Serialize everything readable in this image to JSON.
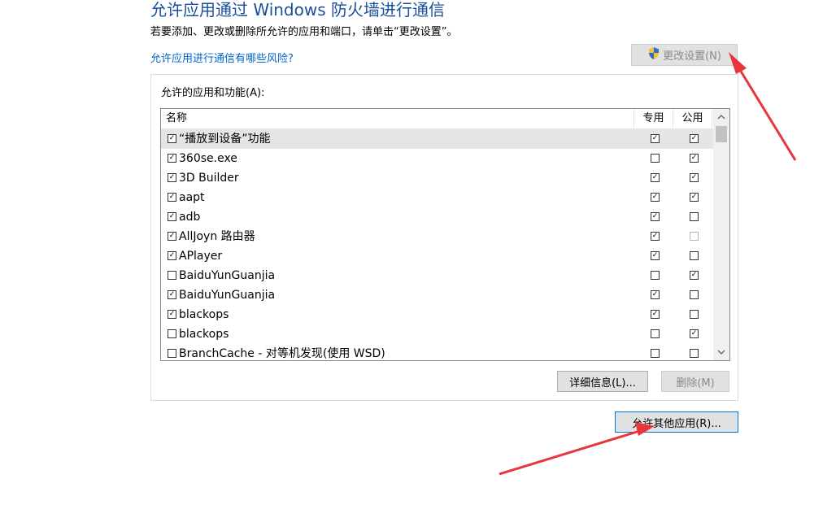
{
  "header": {
    "title": "允许应用通过 Windows 防火墙进行通信",
    "description": "若要添加、更改或删除所允许的应用和端口，请单击“更改设置”。",
    "risk_link": "允许应用进行通信有哪些风险?",
    "change_settings_label": "更改设置(N)"
  },
  "group": {
    "label": "允许的应用和功能(A):"
  },
  "table": {
    "columns": {
      "name": "名称",
      "private": "专用",
      "public": "公用"
    },
    "rows": [
      {
        "name": "“播放到设备”功能",
        "enabled": true,
        "private": true,
        "public": true
      },
      {
        "name": "360se.exe",
        "enabled": true,
        "private": false,
        "public": true
      },
      {
        "name": "3D Builder",
        "enabled": true,
        "private": true,
        "public": true
      },
      {
        "name": "aapt",
        "enabled": true,
        "private": true,
        "public": true
      },
      {
        "name": "adb",
        "enabled": true,
        "private": true,
        "public": false
      },
      {
        "name": "AllJoyn 路由器",
        "enabled": true,
        "private": true,
        "public": false
      },
      {
        "name": "APlayer",
        "enabled": true,
        "private": true,
        "public": false
      },
      {
        "name": "BaiduYunGuanjia",
        "enabled": false,
        "private": false,
        "public": true
      },
      {
        "name": "BaiduYunGuanjia",
        "enabled": true,
        "private": true,
        "public": false
      },
      {
        "name": "blackops",
        "enabled": true,
        "private": true,
        "public": false
      },
      {
        "name": "blackops",
        "enabled": false,
        "private": false,
        "public": true
      },
      {
        "name": "BranchCache - 对等机发现(使用 WSD)",
        "enabled": false,
        "private": false,
        "public": false
      }
    ]
  },
  "buttons": {
    "details": "详细信息(L)...",
    "delete": "删除(M)",
    "allow_other": "允许其他应用(R)..."
  },
  "colors": {
    "title": "#1a4f9c",
    "link": "#0066cc",
    "annotation_arrow": "#e8343a",
    "focus_border": "#0078d7"
  },
  "icons": {
    "shield": "uac-shield-icon",
    "scroll_up": "chevron-up-icon",
    "scroll_down": "chevron-down-icon"
  }
}
